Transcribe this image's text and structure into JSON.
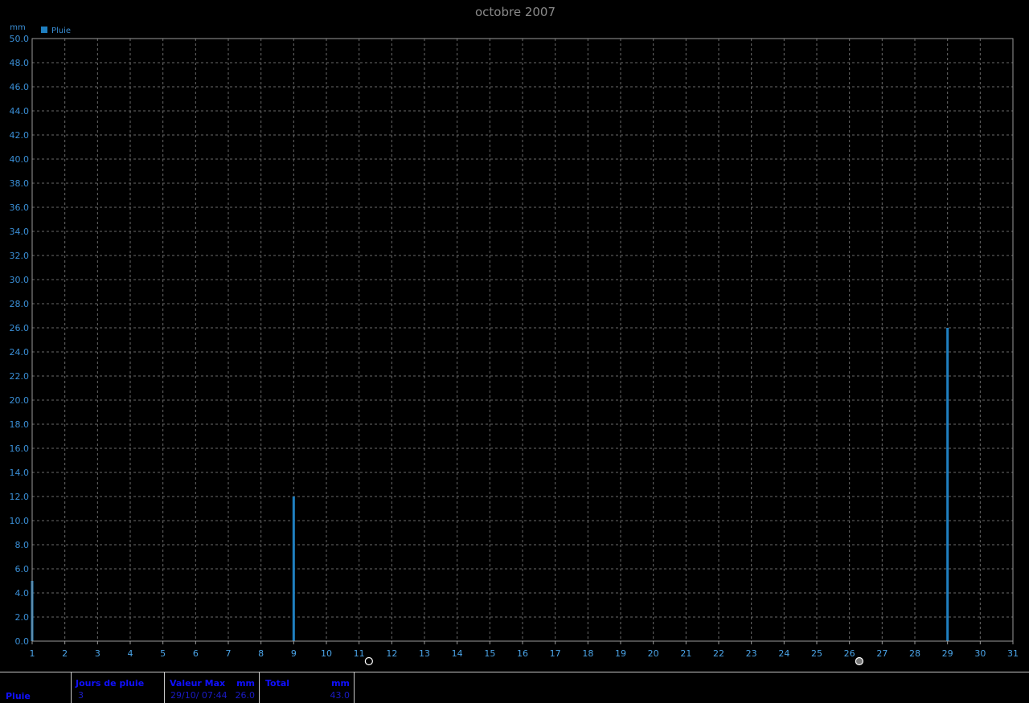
{
  "chart_data": {
    "type": "bar",
    "title": "octobre 2007",
    "ylabel": "mm",
    "legend": [
      "Pluie"
    ],
    "legend_placement": "top-left",
    "grid": true,
    "xlim": [
      1,
      31
    ],
    "ylim": [
      0,
      50
    ],
    "y_ticks": [
      "0.0",
      "2.0",
      "4.0",
      "6.0",
      "8.0",
      "10.0",
      "12.0",
      "14.0",
      "16.0",
      "18.0",
      "20.0",
      "22.0",
      "24.0",
      "26.0",
      "28.0",
      "30.0",
      "32.0",
      "34.0",
      "36.0",
      "38.0",
      "40.0",
      "42.0",
      "44.0",
      "46.0",
      "48.0",
      "50.0"
    ],
    "x_ticks": [
      "1",
      "2",
      "3",
      "4",
      "5",
      "6",
      "7",
      "8",
      "9",
      "10",
      "11",
      "12",
      "13",
      "14",
      "15",
      "16",
      "17",
      "18",
      "19",
      "20",
      "21",
      "22",
      "23",
      "24",
      "25",
      "26",
      "27",
      "28",
      "29",
      "30",
      "31"
    ],
    "series": [
      {
        "name": "Pluie",
        "color": "#1f7fc0",
        "points": [
          {
            "x": 1,
            "y": 5.0
          },
          {
            "x": 9,
            "y": 12.0
          },
          {
            "x": 29,
            "y": 26.0
          }
        ]
      }
    ],
    "moon_phases": [
      {
        "x": 11.3,
        "icon": "full-moon-icon"
      },
      {
        "x": 26.3,
        "icon": "new-moon-icon"
      }
    ]
  },
  "stats": {
    "row_label": "Pluie",
    "jours_label": "Jours de pluie",
    "jours_value": "3",
    "max_label": "Valeur Max",
    "max_unit": "mm",
    "max_date": "29/10/  07:44",
    "max_value": "26.0",
    "total_label": "Total",
    "total_unit": "mm",
    "total_value": "43.0"
  }
}
